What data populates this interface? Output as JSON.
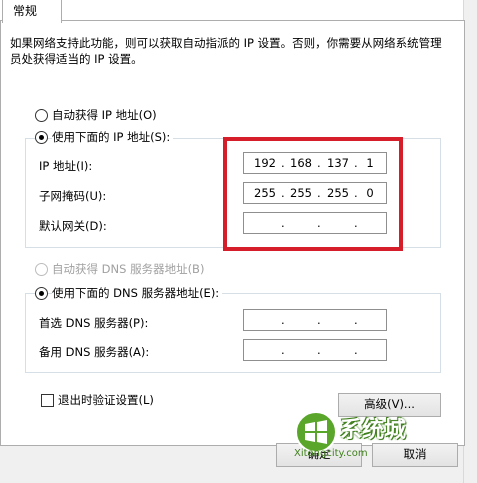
{
  "tab": {
    "label": "常规"
  },
  "description": "如果网络支持此功能，则可以获取自动指派的 IP 设置。否则，你需要从网络系统管理员处获得适当的 IP 设置。",
  "ip_section": {
    "auto_option": "自动获得 IP 地址(O)",
    "manual_option": "使用下面的 IP 地址(S):",
    "selected": "manual",
    "fields": [
      {
        "label": "IP 地址(I):",
        "octets": [
          "192",
          "168",
          "137",
          "1"
        ]
      },
      {
        "label": "子网掩码(U):",
        "octets": [
          "255",
          "255",
          "255",
          "0"
        ]
      },
      {
        "label": "默认网关(D):",
        "octets": [
          "",
          "",
          "",
          ""
        ]
      }
    ]
  },
  "dns_section": {
    "auto_option": "自动获得 DNS 服务器地址(B)",
    "manual_option": "使用下面的 DNS 服务器地址(E):",
    "selected": "manual",
    "fields": [
      {
        "label": "首选 DNS 服务器(P):",
        "octets": [
          "",
          "",
          "",
          ""
        ]
      },
      {
        "label": "备用 DNS 服务器(A):",
        "octets": [
          "",
          "",
          "",
          ""
        ]
      }
    ]
  },
  "validate_checkbox": {
    "label": "退出时验证设置(L)",
    "checked": false
  },
  "advanced_button": "高级(V)...",
  "ok_button": "确定",
  "cancel_button": "取消",
  "watermark": {
    "brand": "系统城",
    "url": "Xitongcity.com"
  },
  "colors": {
    "highlight": "#d51e2a",
    "watermark_green": "#5aa62a"
  }
}
